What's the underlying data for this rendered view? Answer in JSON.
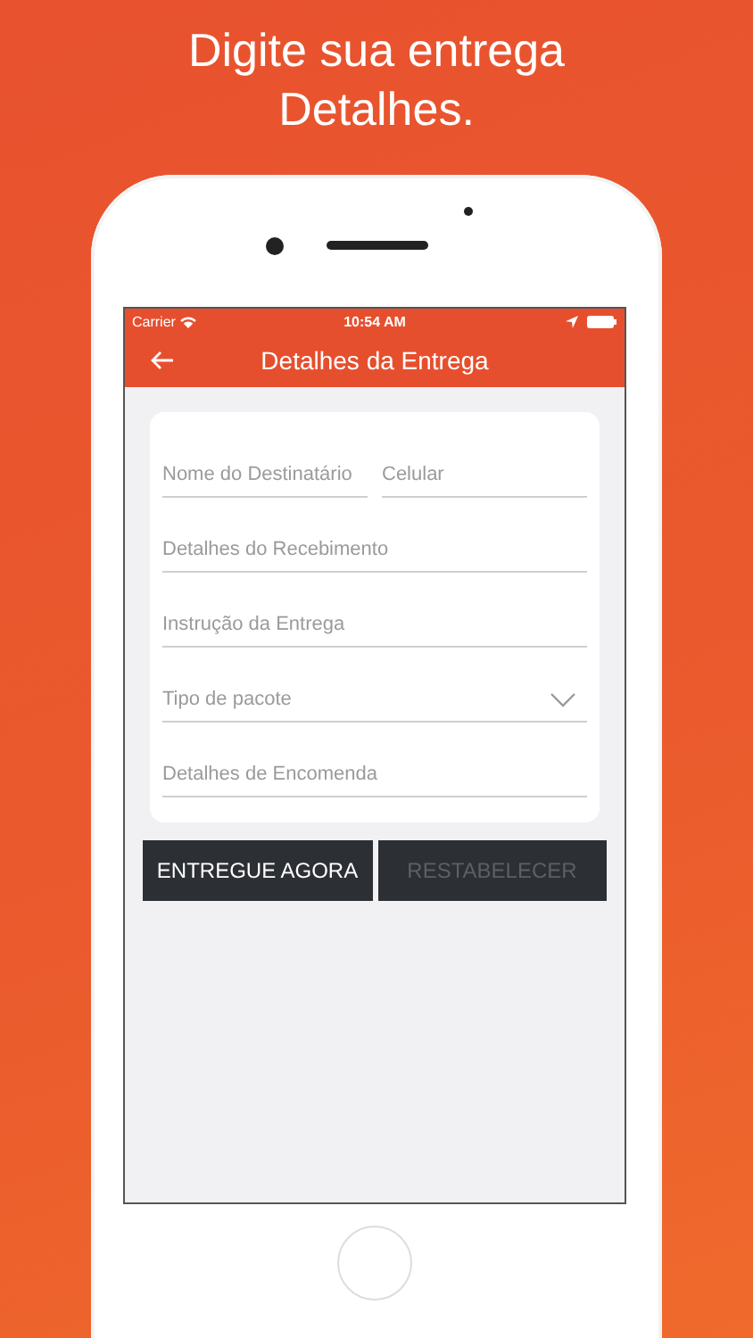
{
  "headline": "Digite sua entrega Detalhes.",
  "status_bar": {
    "carrier": "Carrier",
    "time": "10:54 AM"
  },
  "nav": {
    "title": "Detalhes da Entrega"
  },
  "form": {
    "rows": [
      [
        {
          "kind": "text",
          "placeholder": "Nome do Destinatário"
        },
        {
          "kind": "text",
          "placeholder": "Celular"
        }
      ],
      [
        {
          "kind": "text",
          "placeholder": "Detalhes do Recebimento"
        }
      ],
      [
        {
          "kind": "text",
          "placeholder": "Instrução da Entrega"
        }
      ],
      [
        {
          "kind": "select",
          "placeholder": "Tipo de pacote"
        }
      ],
      [
        {
          "kind": "text",
          "placeholder": "Detalhes de Encomenda"
        }
      ]
    ]
  },
  "buttons": [
    {
      "label": "ENTREGUE AGORA",
      "disabled": false
    },
    {
      "label": "RESTABELECER",
      "disabled": true
    }
  ]
}
